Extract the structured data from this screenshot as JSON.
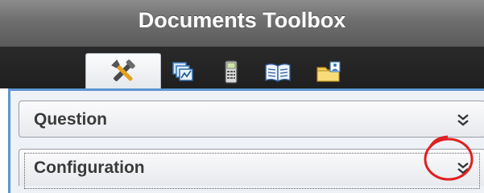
{
  "window": {
    "title": "Documents Toolbox"
  },
  "tabs": [
    {
      "icon": "tools-icon",
      "active": true
    },
    {
      "icon": "page-sorter-icon",
      "active": false
    },
    {
      "icon": "calculator-icon",
      "active": false
    },
    {
      "icon": "book-icon",
      "active": false
    },
    {
      "icon": "content-explorer-icon",
      "active": false
    }
  ],
  "sections": [
    {
      "label": "Question",
      "toggle_icon": "double-chevron-down-icon"
    },
    {
      "label": "Configuration",
      "toggle_icon": "double-chevron-down-icon",
      "focused": true
    }
  ],
  "annotation": {
    "icon": "red-circle-annotation",
    "color": "#e02020"
  },
  "colors": {
    "title_bar": "#6e6e6e",
    "tab_strip": "#242424",
    "panel_border": "#5b95d3",
    "panel_background": "#eef1f5"
  }
}
